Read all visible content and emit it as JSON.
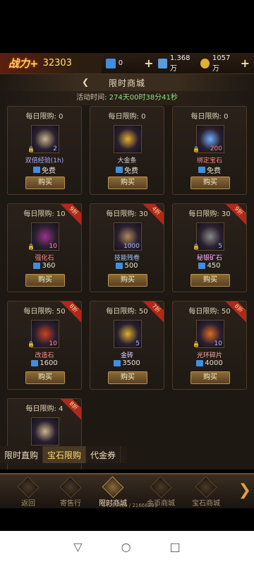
{
  "hud": {
    "power_label": "战力+",
    "power_value": "32303",
    "ticket1": "0",
    "ticket2": "1.368万",
    "gold": "1057万",
    "plus": "+"
  },
  "title": "限时商城",
  "timer": {
    "label": "活动时间: ",
    "value": "274天00时38分41秒"
  },
  "items": [
    {
      "limit": "每日限购: 0",
      "name": "双倍经验(1h)",
      "count": "2",
      "price": "免费",
      "discount": "",
      "name_color": "#b0b0ff",
      "color": "#c9b78a"
    },
    {
      "limit": "每日限购: 0",
      "name": "大金条",
      "count": "",
      "price": "免费",
      "discount": "",
      "name_color": "#d8d8d8",
      "color": "#e6b030"
    },
    {
      "limit": "每日限购: 0",
      "name": "绑定宝石",
      "count": "200",
      "price": "免费",
      "discount": "",
      "name_color": "#ff8080",
      "color": "#6fb0ff"
    },
    {
      "limit": "每日限购: 10",
      "name": "强化石",
      "count": "10",
      "price": "360",
      "discount": "9折",
      "name_color": "#ff9090",
      "color": "#a0308a"
    },
    {
      "limit": "每日限购: 30",
      "name": "技能残卷",
      "count": "1000",
      "price": "500",
      "discount": "4折",
      "name_color": "#a0c8ff",
      "color": "#b08a5a"
    },
    {
      "limit": "每日限购: 30",
      "name": "秘银矿石",
      "count": "5",
      "price": "450",
      "discount": "9折",
      "name_color": "#ffb0ff",
      "color": "#8a8a8a"
    },
    {
      "limit": "每日限购: 50",
      "name": "改造石",
      "count": "10",
      "price": "1600",
      "discount": "8折",
      "name_color": "#ff9090",
      "color": "#d04020"
    },
    {
      "limit": "每日限购: 50",
      "name": "金砖",
      "count": "5",
      "price": "3500",
      "discount": "7折",
      "name_color": "#e0d0ff",
      "color": "#e0b030"
    },
    {
      "limit": "每日限购: 50",
      "name": "光环碎片",
      "count": "10",
      "price": "4000",
      "discount": "8折",
      "name_color": "#ffb0b0",
      "color": "#e06a20"
    },
    {
      "limit": "每日限购: 4",
      "name": "",
      "count": "",
      "price": "",
      "discount": "8折",
      "name_color": "#b0b0ff",
      "color": "#c9b78a"
    }
  ],
  "buy_label": "购买",
  "tabs": [
    "限时直购",
    "宝石限购",
    "代金券"
  ],
  "nav": [
    "返回",
    "寄售行",
    "限时商城",
    "金币商城",
    "宝石商城"
  ],
  "coords": "14099460 / 21666293"
}
